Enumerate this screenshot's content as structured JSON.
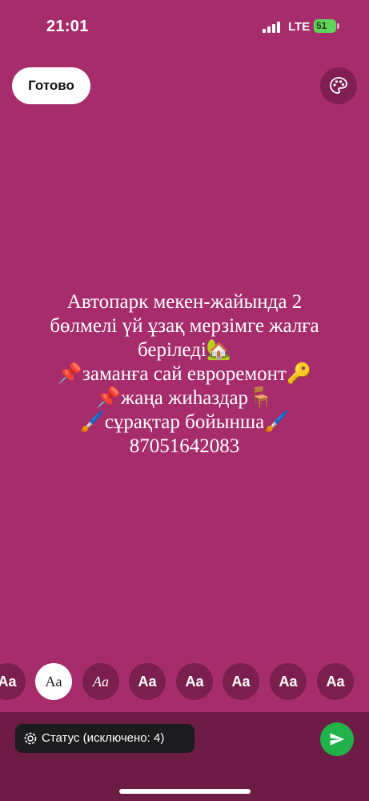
{
  "status_bar": {
    "time": "21:01",
    "network": "LTE",
    "battery": "51"
  },
  "toolbar": {
    "done_label": "Готово",
    "palette_icon": "palette-icon"
  },
  "story": {
    "lines": [
      "Автопарк мекен-жайында 2",
      "бөлмелі үй ұзақ мерзімге жалға",
      "беріледі🏡",
      "📌заманға сай евроремонт🔑",
      "📌жаңа жиһаздар🪑",
      "🖌️сұрақтар бойынша🖌️",
      "87051642083"
    ]
  },
  "font_picker": {
    "options": [
      "Aa",
      "Aa",
      "Aa",
      "Aa",
      "Aa",
      "Aa",
      "Aa",
      "Aa"
    ],
    "selected_index": 1
  },
  "footer": {
    "status_label": "Статус (исключено: 4)",
    "send_icon": "send-icon"
  },
  "colors": {
    "background": "#a62c6b",
    "bottom_bar": "#6d1c45",
    "send": "#21b34a",
    "battery": "#5fd35a"
  }
}
